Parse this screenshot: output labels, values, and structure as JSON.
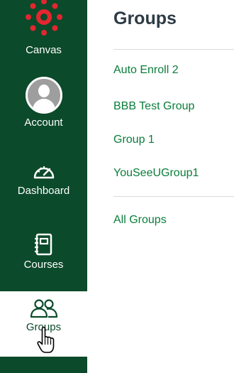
{
  "nav": {
    "items": [
      {
        "label": "Canvas",
        "icon": "canvas-logo-icon"
      },
      {
        "label": "Account",
        "icon": "user-avatar-icon"
      },
      {
        "label": "Dashboard",
        "icon": "dashboard-gauge-icon"
      },
      {
        "label": "Courses",
        "icon": "courses-book-icon"
      },
      {
        "label": "Groups",
        "icon": "groups-people-icon"
      }
    ],
    "colors": {
      "background": "#0b4a2a",
      "active_background": "#ffffff",
      "text": "#ffffff"
    }
  },
  "main": {
    "title": "Groups",
    "groups": [
      {
        "name": "Auto Enroll 2"
      },
      {
        "name": "BBB Test Group"
      },
      {
        "name": "Group 1"
      },
      {
        "name": "YouSeeUGroup1"
      }
    ],
    "all_groups_link": "All Groups",
    "colors": {
      "link": "#0a7d3b",
      "title": "#2d3b45"
    }
  }
}
